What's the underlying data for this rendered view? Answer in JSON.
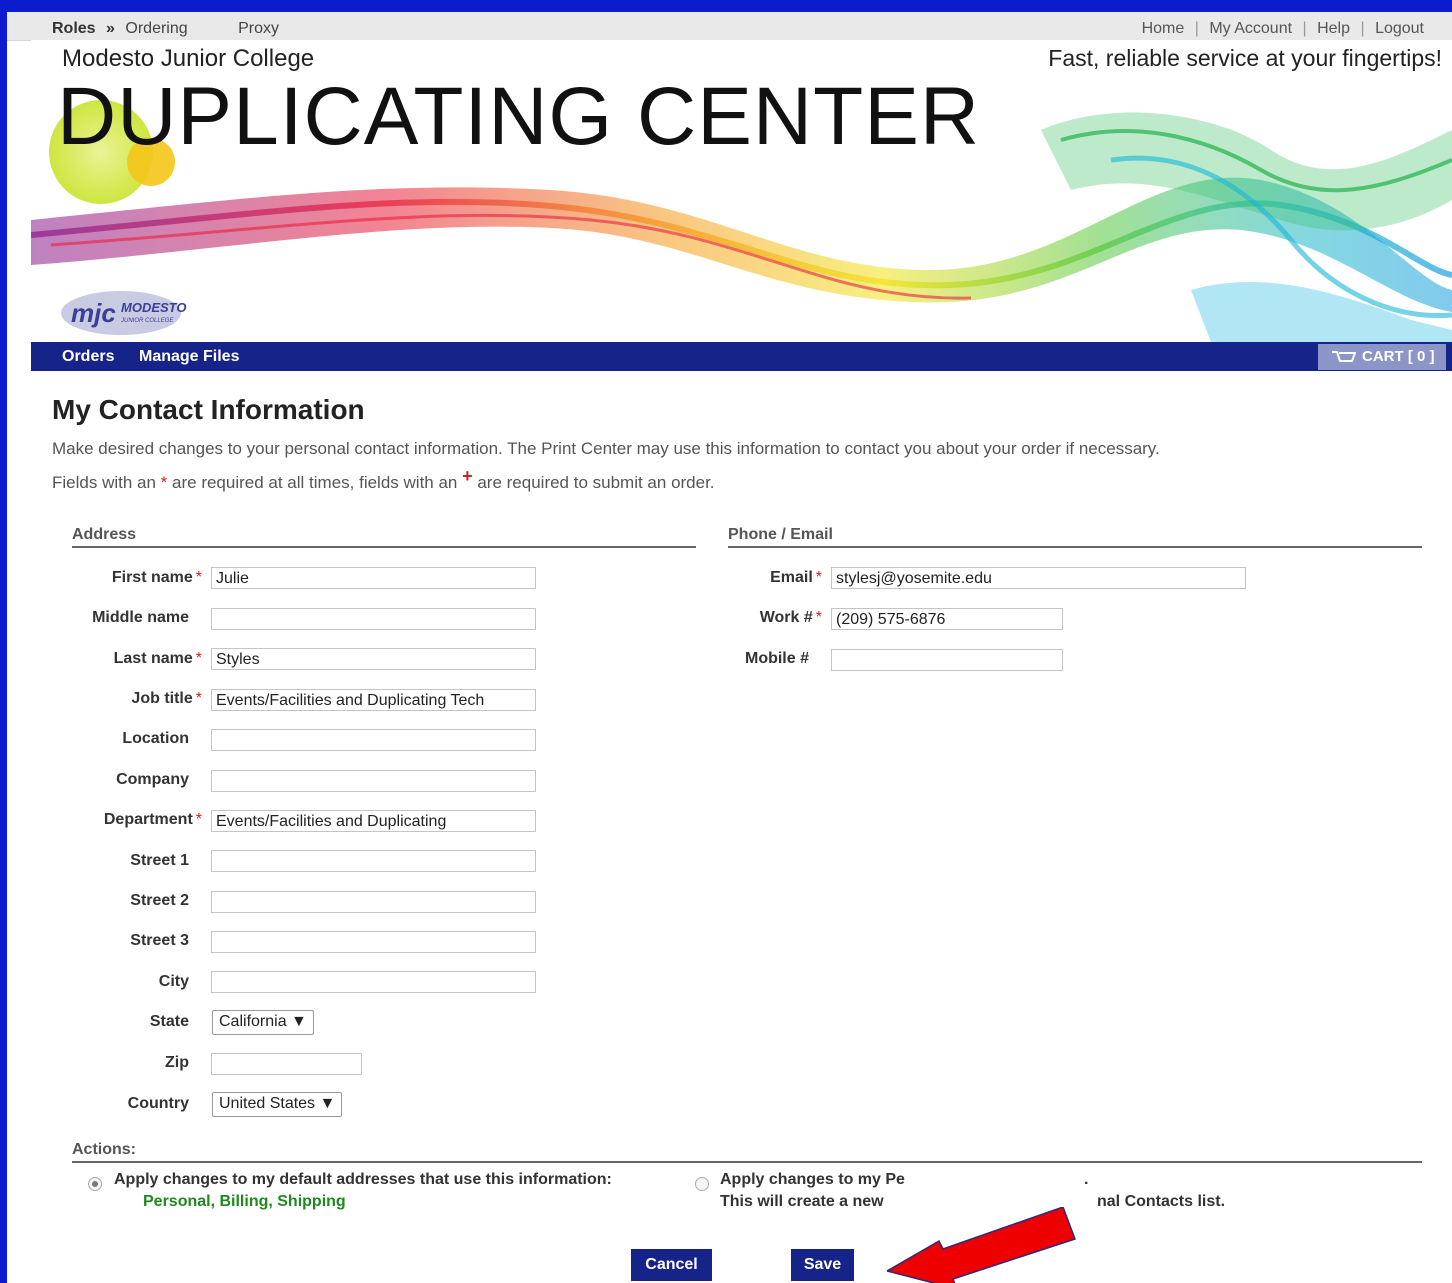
{
  "topbar": {
    "roles_label": "Roles",
    "roles_separator": "»",
    "ordering_label": "Ordering",
    "proxy_label": "Proxy",
    "home_link": "Home",
    "account_link": "My Account",
    "help_link": "Help",
    "logout_link": "Logout",
    "separator": "|"
  },
  "header": {
    "college_name": "Modesto Junior College",
    "tagline": "Fast, reliable service at your fingertips!",
    "center_title": "DUPLICATING CENTER",
    "logo_text": "MODESTO",
    "logo_subtext": "JUNIOR COLLEGE",
    "logo_initials": "mjc"
  },
  "nav": {
    "orders": "Orders",
    "manage_files": "Manage Files",
    "cart": "CART [ 0 ]"
  },
  "main": {
    "title": "My Contact Information",
    "intro": "Make desired changes to your personal contact information. The Print Center may use this information to contact you about your order if necessary.",
    "required_prefix": "Fields with an ",
    "required_star": "*",
    "required_middle": " are required at all times, fields with an ",
    "required_plus": "+",
    "required_suffix": " are required to submit an order."
  },
  "address": {
    "heading": "Address",
    "first_name": {
      "label": "First name",
      "value": "Julie"
    },
    "middle_name": {
      "label": "Middle name",
      "value": ""
    },
    "last_name": {
      "label": "Last name",
      "value": "Styles"
    },
    "job_title": {
      "label": "Job title",
      "value": "Events/Facilities and Duplicating Tech"
    },
    "location": {
      "label": "Location",
      "value": ""
    },
    "company": {
      "label": "Company",
      "value": ""
    },
    "department": {
      "label": "Department",
      "value": "Events/Facilities and Duplicating"
    },
    "street1": {
      "label": "Street 1",
      "value": ""
    },
    "street2": {
      "label": "Street 2",
      "value": ""
    },
    "street3": {
      "label": "Street 3",
      "value": ""
    },
    "city": {
      "label": "City",
      "value": ""
    },
    "state": {
      "label": "State",
      "value": "California ▼"
    },
    "zip": {
      "label": "Zip",
      "value": ""
    },
    "country": {
      "label": "Country",
      "value": "United States ▼"
    }
  },
  "phone": {
    "heading": "Phone / Email",
    "email": {
      "label": "Email",
      "value": "stylesj@yosemite.edu"
    },
    "work": {
      "label": "Work #",
      "value": "(209) 575-6876"
    },
    "mobile": {
      "label": "Mobile #",
      "value": ""
    }
  },
  "required_marker": "*",
  "actions": {
    "heading": "Actions:",
    "option1_line1": "Apply changes to my default addresses that use this information:",
    "option1_line2": "Personal, Billing, Shipping",
    "option2_line1a": "Apply changes to my Pe",
    "option2_line1b": ".",
    "option2_line2a": "This will create a new",
    "option2_line2b": "nal Contacts list.",
    "cancel": "Cancel",
    "save": "Save"
  },
  "colors": {
    "frame_blue": "#0b1ccf",
    "nav_navy": "#16248a",
    "required_red": "#cc2222",
    "link_green": "#1e8a1e",
    "annotation_arrow": "#ee0000"
  }
}
